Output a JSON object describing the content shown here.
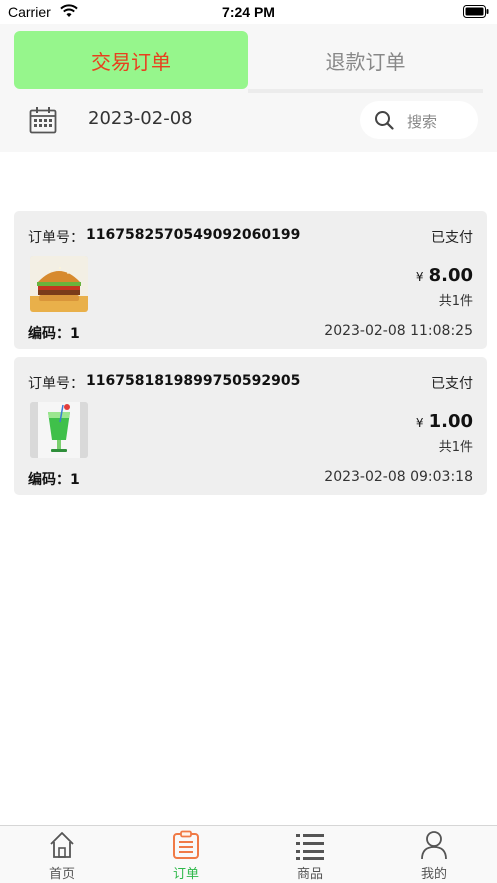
{
  "status_bar": {
    "carrier": "Carrier",
    "time": "7:24 PM"
  },
  "tabs": {
    "active": "交易订单",
    "inactive": "退款订单"
  },
  "filter": {
    "date": "2023-02-08",
    "search_placeholder": "搜索"
  },
  "order_labels": {
    "order_no": "订单号：",
    "code": "编码：",
    "currency": "¥"
  },
  "orders": [
    {
      "order_no": "1167582570549092060199",
      "status": "已支付",
      "thumb_icon": "burger-photo",
      "price": "8.00",
      "qty": "共1件",
      "code_value": "1",
      "time": "2023-02-08 11:08:25"
    },
    {
      "order_no": "1167581819899750592905",
      "status": "已支付",
      "thumb_icon": "green-drink-photo",
      "price": "1.00",
      "qty": "共1件",
      "code_value": "1",
      "time": "2023-02-08 09:03:18"
    }
  ],
  "bottom_nav": [
    {
      "label": "首页",
      "icon": "home-icon",
      "active": false
    },
    {
      "label": "订单",
      "icon": "order-list-icon",
      "active": true
    },
    {
      "label": "商品",
      "icon": "list-icon",
      "active": false
    },
    {
      "label": "我的",
      "icon": "user-icon",
      "active": false
    }
  ],
  "colors": {
    "active_tab_bg": "#96f68c",
    "active_tab_text": "#e8401e",
    "active_nav": "#2fb84a",
    "order_icon": "#f07a46"
  }
}
